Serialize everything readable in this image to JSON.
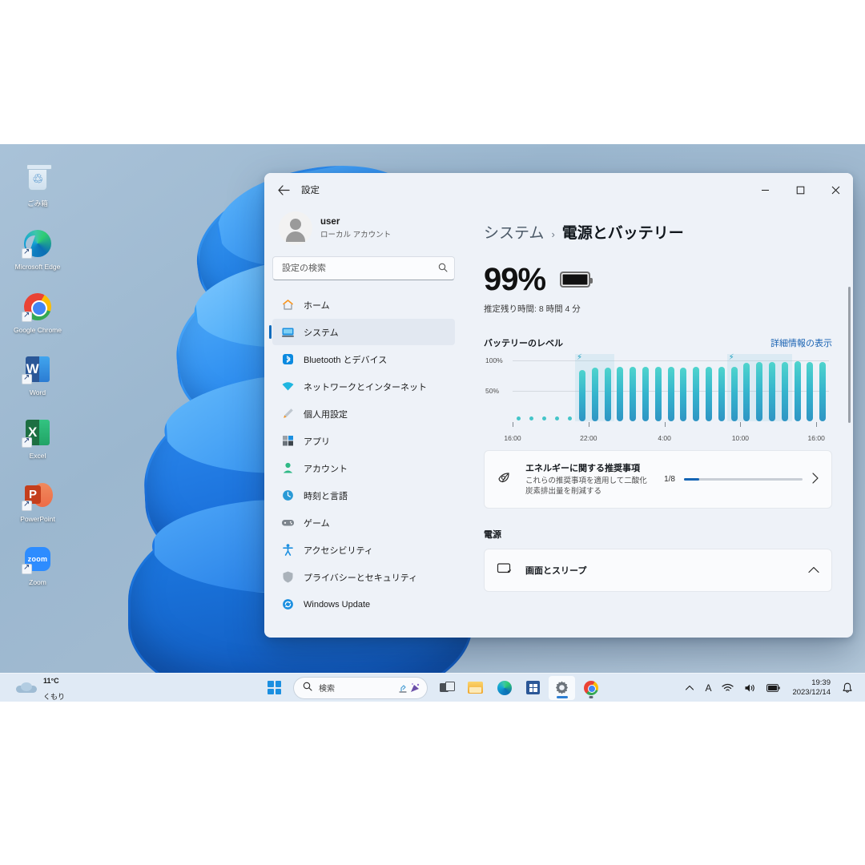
{
  "desktop": {
    "icons": [
      {
        "label": "ごみ箱",
        "icon": "recycle-bin-icon"
      },
      {
        "label": "Microsoft Edge",
        "icon": "edge-icon"
      },
      {
        "label": "Google Chrome",
        "icon": "chrome-icon"
      },
      {
        "label": "Word",
        "icon": "word-icon",
        "glyph": "W"
      },
      {
        "label": "Excel",
        "icon": "excel-icon",
        "glyph": "X"
      },
      {
        "label": "PowerPoint",
        "icon": "powerpoint-icon",
        "glyph": "P"
      },
      {
        "label": "Zoom",
        "icon": "zoom-icon",
        "glyph": "zoom"
      }
    ]
  },
  "window": {
    "title": "設定",
    "back_icon": "back-arrow-icon",
    "controls": {
      "minimize": "−",
      "maximize": "▢",
      "close": "✕"
    }
  },
  "sidebar": {
    "profile": {
      "name": "user",
      "account_type": "ローカル アカウント",
      "avatar_icon": "avatar-icon"
    },
    "search": {
      "placeholder": "設定の検索",
      "value": "",
      "icon": "search-icon"
    },
    "items": [
      {
        "label": "ホーム",
        "icon": "home-icon",
        "active": false
      },
      {
        "label": "システム",
        "icon": "system-icon",
        "active": true
      },
      {
        "label": "Bluetooth とデバイス",
        "icon": "bluetooth-icon",
        "active": false
      },
      {
        "label": "ネットワークとインターネット",
        "icon": "network-icon",
        "active": false
      },
      {
        "label": "個人用設定",
        "icon": "personalization-icon",
        "active": false
      },
      {
        "label": "アプリ",
        "icon": "apps-icon",
        "active": false
      },
      {
        "label": "アカウント",
        "icon": "accounts-icon",
        "active": false
      },
      {
        "label": "時刻と言語",
        "icon": "time-language-icon",
        "active": false
      },
      {
        "label": "ゲーム",
        "icon": "gaming-icon",
        "active": false
      },
      {
        "label": "アクセシビリティ",
        "icon": "accessibility-icon",
        "active": false
      },
      {
        "label": "プライバシーとセキュリティ",
        "icon": "privacy-icon",
        "active": false
      },
      {
        "label": "Windows Update",
        "icon": "windows-update-icon",
        "active": false
      }
    ]
  },
  "main": {
    "breadcrumb": {
      "root": "システム",
      "separator": "›",
      "current": "電源とバッテリー"
    },
    "battery": {
      "percent": "99%",
      "icon": "battery-full-icon",
      "estimate": "推定残り時間: 8 時間 4 分"
    },
    "battery_level_section": {
      "title": "バッテリーのレベル",
      "detail_link": "詳細情報の表示"
    },
    "energy_card": {
      "icon": "leaf-eye-icon",
      "title": "エネルギーに関する推奨事項",
      "subtitle": "これらの推奨事項を適用して二酸化炭素排出量を削減する",
      "progress_label": "1/8",
      "progress_percent": 12.5,
      "chevron": "chevron-right-icon"
    },
    "power_section": {
      "title": "電源",
      "rows": [
        {
          "label": "画面とスリープ",
          "icon": "screen-sleep-icon",
          "chevron": "chevron-up-icon"
        }
      ]
    },
    "scrollbar": "vertical-scrollbar"
  },
  "chart_data": {
    "type": "bar",
    "title": "バッテリーのレベル",
    "xlabel": "",
    "ylabel": "",
    "ylim": [
      0,
      100
    ],
    "grid": true,
    "ytick_labels": [
      "100%",
      "50%"
    ],
    "ytick_values": [
      100,
      50
    ],
    "xtick_labels": [
      "16:00",
      "22:00",
      "4:00",
      "10:00",
      "16:00"
    ],
    "xtick_positions": [
      0,
      6,
      12,
      18,
      24
    ],
    "x_hours": [
      16,
      17,
      18,
      19,
      20,
      21,
      22,
      23,
      0,
      1,
      2,
      3,
      4,
      5,
      6,
      7,
      8,
      9,
      10,
      11,
      12,
      13,
      14,
      15,
      16
    ],
    "values": [
      0,
      0,
      0,
      0,
      0,
      84,
      88,
      88,
      89,
      89,
      89,
      89,
      89,
      88,
      89,
      89,
      89,
      90,
      96,
      98,
      98,
      98,
      99,
      98,
      98
    ],
    "marker_style": [
      "dot",
      "dot",
      "dot",
      "dot",
      "dot",
      "bar",
      "bar",
      "bar",
      "bar",
      "bar",
      "bar",
      "bar",
      "bar",
      "bar",
      "bar",
      "bar",
      "bar",
      "bar",
      "bar",
      "bar",
      "bar",
      "bar",
      "bar",
      "bar",
      "bar"
    ],
    "charging_bands": [
      {
        "start_index": 5,
        "end_index": 7,
        "icon": "lightning-bolt-icon"
      },
      {
        "start_index": 17,
        "end_index": 21,
        "icon": "lightning-bolt-icon"
      }
    ],
    "colors": {
      "bar_top": "#4FD4CD",
      "bar_bottom": "#2F95C4",
      "dot": "#44C5C9",
      "gridline": "#D4D9E0",
      "charging_band": "rgba(126,196,221,0.17)"
    }
  },
  "taskbar": {
    "weather": {
      "temperature": "11°C",
      "condition": "くもり",
      "icon": "cloudy-icon"
    },
    "start": {
      "label": "スタート",
      "icon": "windows-start-icon"
    },
    "search": {
      "placeholder": "検索",
      "icon": "search-icon"
    },
    "apps": [
      {
        "name": "タスク ビュー",
        "icon": "task-view-icon",
        "state": "idle"
      },
      {
        "name": "エクスプローラー",
        "icon": "file-explorer-icon",
        "state": "idle"
      },
      {
        "name": "Microsoft Edge",
        "icon": "edge-icon",
        "state": "idle"
      },
      {
        "name": "Microsoft Store",
        "icon": "microsoft-store-icon",
        "state": "idle"
      },
      {
        "name": "設定",
        "icon": "settings-gear-icon",
        "state": "active"
      },
      {
        "name": "Google Chrome",
        "icon": "chrome-icon",
        "state": "running"
      }
    ],
    "tray": {
      "chevron": "show-hidden-icons-icon",
      "ime": "A",
      "wifi": "wifi-icon",
      "volume": "volume-icon",
      "battery": "battery-icon",
      "time": "19:39",
      "date": "2023/12/14",
      "notification": "bell-icon"
    }
  }
}
